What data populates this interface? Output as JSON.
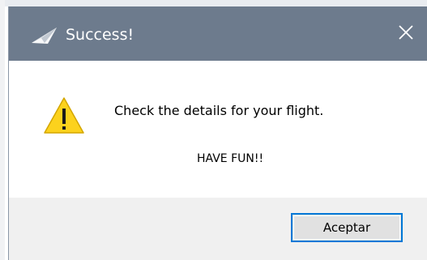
{
  "dialog": {
    "title": "Success!",
    "title_icon": "paper-plane-icon",
    "close_icon": "close-icon",
    "warning_icon": "warning-triangle-icon",
    "message": "Check the details for your flight.",
    "submessage": "HAVE FUN!!",
    "ok_label": "Aceptar",
    "colors": {
      "titlebar": "#6d7b8d",
      "button_focus_border": "#0078d7",
      "footer": "#f0f0f0",
      "warning_fill": "#fcd21d"
    }
  }
}
